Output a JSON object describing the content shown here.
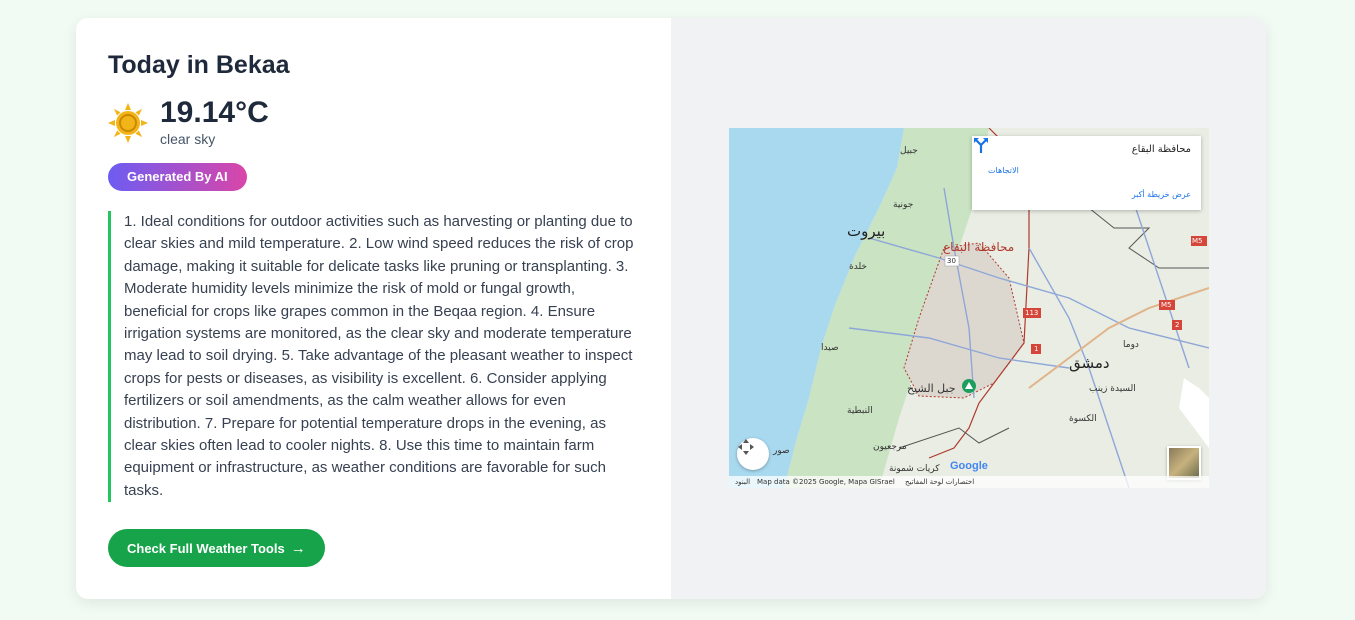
{
  "header": {
    "title": "Today in Bekaa"
  },
  "weather": {
    "icon": "sun-icon",
    "temperature": "19.14°C",
    "description": "clear sky"
  },
  "badge": {
    "label": "Generated By AI"
  },
  "advice": {
    "text": "1. Ideal conditions for outdoor activities such as harvesting or planting due to clear skies and mild temperature. 2. Low wind speed reduces the risk of crop damage, making it suitable for delicate tasks like pruning or transplanting. 3. Moderate humidity levels minimize the risk of mold or fungal growth, beneficial for crops like grapes common in the Beqaa region. 4. Ensure irrigation systems are monitored, as the clear sky and moderate temperature may lead to soil drying. 5. Take advantage of the pleasant weather to inspect crops for pests or diseases, as visibility is excellent. 6. Consider applying fertilizers or soil amendments, as the calm weather allows for even distribution. 7. Prepare for potential temperature drops in the evening, as clear skies often lead to cooler nights. 8. Use this time to maintain farm equipment or infrastructure, as weather conditions are favorable for such tasks."
  },
  "cta": {
    "label": "Check Full Weather Tools",
    "arrow": "→"
  },
  "map": {
    "info": {
      "place_name": "محافظة البقاع",
      "directions_label": "الاتجاهات",
      "view_larger": "عرض خريطة أكبر"
    },
    "labels": {
      "beirut": "بيروت",
      "bekaa": "محافظة البقاع",
      "damascus": "دمشق",
      "jbeil": "جبيل",
      "jounieh": "جونية",
      "khalde": "خلدة",
      "saida": "صيدا",
      "nabatieh": "النبطية",
      "tyre": "صور",
      "marjayoun": "مرجعيون",
      "hermon": "جبل الشيخ",
      "douma": "دوما",
      "sayyida_zaynab": "السيدة زينب",
      "kisweh": "الكسوة",
      "golan": "كريات شمونة",
      "route30": "30",
      "route113": "113",
      "route1": "1",
      "m5": "M5",
      "m5b": "M5",
      "route2": "2"
    },
    "attribution": {
      "terms": "البنود",
      "data": "Map data ©2025 Google, Mapa GISrael",
      "shortcuts": "اختصارات لوحة المفاتيح"
    },
    "google_logo": "Google",
    "colors": {
      "sea": "#a8d9ef",
      "land": "#e8eee2",
      "green": "#c9e3c3",
      "border": "#b03a2e"
    }
  },
  "colors": {
    "accent_green": "#16a34a",
    "badge_from": "#6d5cf2",
    "badge_to": "#d946a8",
    "sun": "#f2b418"
  }
}
